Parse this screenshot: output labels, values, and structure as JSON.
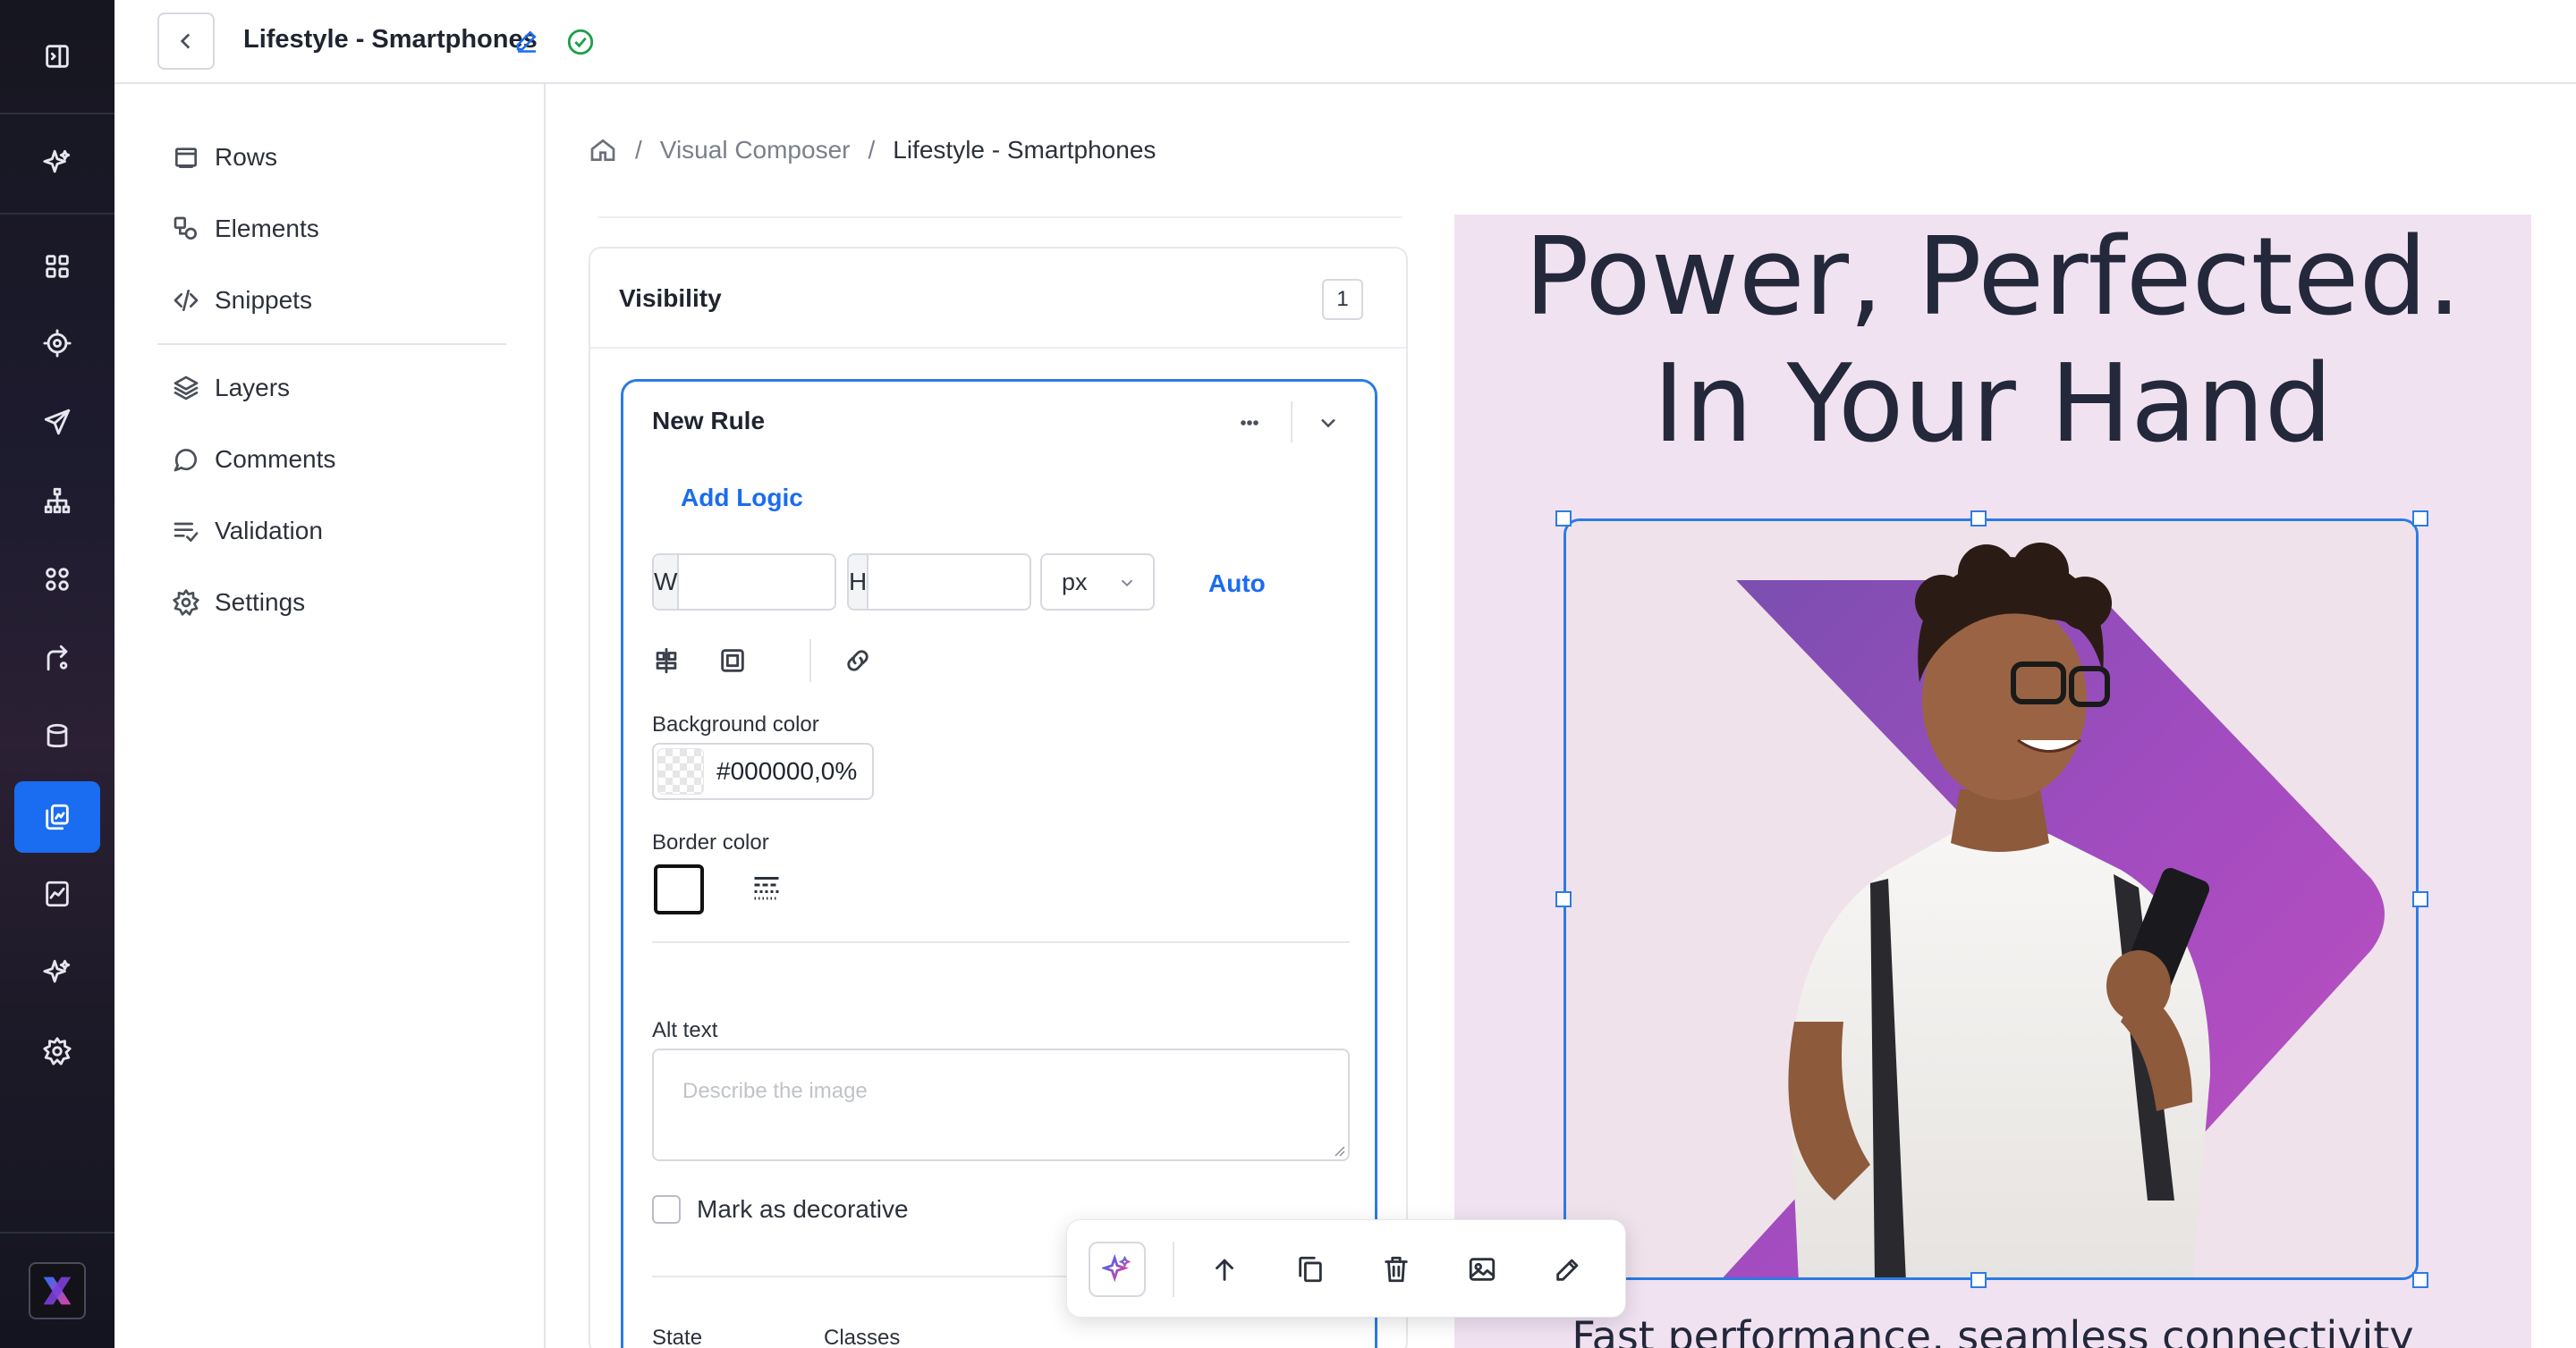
{
  "app": {
    "document_title": "Lifestyle - Smartphones",
    "brand_color": "#1a6cf0"
  },
  "rail": {
    "items": [
      "collapse-sidebar-icon",
      "ai-sparkle-icon",
      "dashboard-grid-icon",
      "target-icon",
      "send-icon",
      "sitemap-icon",
      "apps-icon",
      "route-icon",
      "database-icon",
      "pages-icon",
      "analytics-icon",
      "sparkle-icon",
      "settings-icon"
    ],
    "active": "pages-icon"
  },
  "sidebar": {
    "items": [
      {
        "label": "Rows",
        "icon": "rows-icon"
      },
      {
        "label": "Elements",
        "icon": "elements-icon"
      },
      {
        "label": "Snippets",
        "icon": "code-icon"
      },
      {
        "label": "Layers",
        "icon": "layers-icon"
      },
      {
        "label": "Comments",
        "icon": "comment-icon"
      },
      {
        "label": "Validation",
        "icon": "checklist-icon"
      },
      {
        "label": "Settings",
        "icon": "gear-icon"
      }
    ]
  },
  "breadcrumb": {
    "items": [
      "Visual Composer",
      "Lifestyle - Smartphones"
    ]
  },
  "panel": {
    "section_title": "Visibility",
    "section_count": "1",
    "rule": {
      "title": "New Rule",
      "add_logic": "Add Logic",
      "width_label": "W",
      "width_value": "",
      "height_label": "H",
      "height_value": "",
      "unit": "px",
      "auto_label": "Auto",
      "background_label": "Background color",
      "background_value": "#000000,0%",
      "border_label": "Border color",
      "alt_label": "Alt text",
      "alt_placeholder": "Describe the image",
      "decorative_label": "Mark as decorative",
      "decorative_checked": false,
      "state_label": "State",
      "classes_label": "Classes"
    }
  },
  "canvas": {
    "headline_line1": "Power, Perfected.",
    "headline_line2": "In Your Hand",
    "subline": "Fast performance, seamless connectivity",
    "background": "#f1e2f2",
    "accent_shape": "#9b4fbf"
  },
  "floating_toolbar": {
    "buttons": [
      "ai-sparkle-icon",
      "arrow-up-icon",
      "duplicate-icon",
      "trash-icon",
      "image-icon",
      "pencil-icon"
    ]
  }
}
